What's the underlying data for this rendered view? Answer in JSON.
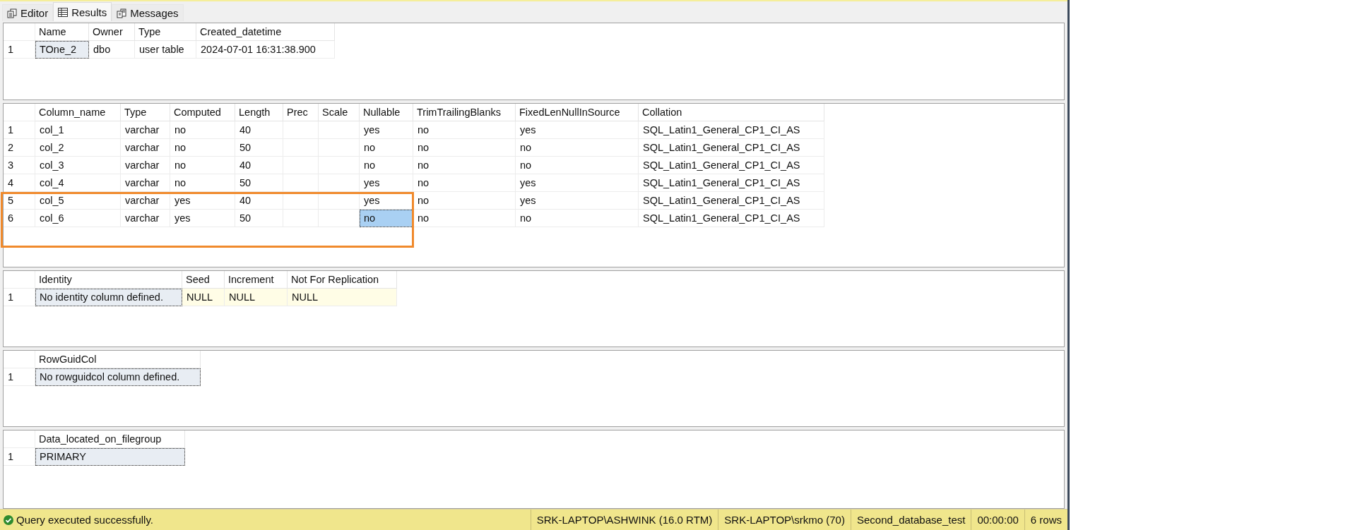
{
  "tabs": [
    {
      "label": "Editor",
      "kind": "editor",
      "selected": false
    },
    {
      "label": "Results",
      "kind": "grid",
      "selected": true
    },
    {
      "label": "Messages",
      "kind": "messages",
      "selected": false
    }
  ],
  "grids": [
    {
      "columns": [
        "Name",
        "Owner",
        "Type",
        "Created_datetime"
      ],
      "rows": [
        {
          "number": "1",
          "outlined": false,
          "cells": [
            {
              "text": "TOne_2",
              "focused": true,
              "selected": false,
              "null": false
            },
            {
              "text": "dbo",
              "focused": false,
              "selected": false,
              "null": false
            },
            {
              "text": "user table",
              "focused": false,
              "selected": false,
              "null": false
            },
            {
              "text": "2024-07-01 16:31:38.900",
              "focused": false,
              "selected": false,
              "null": false
            }
          ]
        }
      ]
    },
    {
      "columns": [
        "Column_name",
        "Type",
        "Computed",
        "Length",
        "Prec",
        "Scale",
        "Nullable",
        "TrimTrailingBlanks",
        "FixedLenNullInSource",
        "Collation"
      ],
      "rows": [
        {
          "number": "1",
          "outlined": false,
          "cells": [
            {
              "text": "col_1",
              "focused": false,
              "selected": false,
              "null": false
            },
            {
              "text": "varchar",
              "focused": false,
              "selected": false,
              "null": false
            },
            {
              "text": "no",
              "focused": false,
              "selected": false,
              "null": false
            },
            {
              "text": "40",
              "focused": false,
              "selected": false,
              "null": false
            },
            {
              "focused": false,
              "selected": false,
              "null": false
            },
            {
              "focused": false,
              "selected": false,
              "null": false
            },
            {
              "text": "yes",
              "focused": false,
              "selected": false,
              "null": false
            },
            {
              "text": "no",
              "focused": false,
              "selected": false,
              "null": false
            },
            {
              "text": "yes",
              "focused": false,
              "selected": false,
              "null": false
            },
            {
              "text": "SQL_Latin1_General_CP1_CI_AS",
              "focused": false,
              "selected": false,
              "null": false
            }
          ]
        },
        {
          "number": "2",
          "outlined": false,
          "cells": [
            {
              "text": "col_2",
              "focused": false,
              "selected": false,
              "null": false
            },
            {
              "text": "varchar",
              "focused": false,
              "selected": false,
              "null": false
            },
            {
              "text": "no",
              "focused": false,
              "selected": false,
              "null": false
            },
            {
              "text": "50",
              "focused": false,
              "selected": false,
              "null": false
            },
            {
              "focused": false,
              "selected": false,
              "null": false
            },
            {
              "focused": false,
              "selected": false,
              "null": false
            },
            {
              "text": "no",
              "focused": false,
              "selected": false,
              "null": false
            },
            {
              "text": "no",
              "focused": false,
              "selected": false,
              "null": false
            },
            {
              "text": "no",
              "focused": false,
              "selected": false,
              "null": false
            },
            {
              "text": "SQL_Latin1_General_CP1_CI_AS",
              "focused": false,
              "selected": false,
              "null": false
            }
          ]
        },
        {
          "number": "3",
          "outlined": false,
          "cells": [
            {
              "text": "col_3",
              "focused": false,
              "selected": false,
              "null": false
            },
            {
              "text": "varchar",
              "focused": false,
              "selected": false,
              "null": false
            },
            {
              "text": "no",
              "focused": false,
              "selected": false,
              "null": false
            },
            {
              "text": "40",
              "focused": false,
              "selected": false,
              "null": false
            },
            {
              "focused": false,
              "selected": false,
              "null": false
            },
            {
              "focused": false,
              "selected": false,
              "null": false
            },
            {
              "text": "no",
              "focused": false,
              "selected": false,
              "null": false
            },
            {
              "text": "no",
              "focused": false,
              "selected": false,
              "null": false
            },
            {
              "text": "no",
              "focused": false,
              "selected": false,
              "null": false
            },
            {
              "text": "SQL_Latin1_General_CP1_CI_AS",
              "focused": false,
              "selected": false,
              "null": false
            }
          ]
        },
        {
          "number": "4",
          "outlined": false,
          "cells": [
            {
              "text": "col_4",
              "focused": false,
              "selected": false,
              "null": false
            },
            {
              "text": "varchar",
              "focused": false,
              "selected": false,
              "null": false
            },
            {
              "text": "no",
              "focused": false,
              "selected": false,
              "null": false
            },
            {
              "text": "50",
              "focused": false,
              "selected": false,
              "null": false
            },
            {
              "focused": false,
              "selected": false,
              "null": false
            },
            {
              "focused": false,
              "selected": false,
              "null": false
            },
            {
              "text": "yes",
              "focused": false,
              "selected": false,
              "null": false
            },
            {
              "text": "no",
              "focused": false,
              "selected": false,
              "null": false
            },
            {
              "text": "yes",
              "focused": false,
              "selected": false,
              "null": false
            },
            {
              "text": "SQL_Latin1_General_CP1_CI_AS",
              "focused": false,
              "selected": false,
              "null": false
            }
          ]
        },
        {
          "number": "5",
          "outlined": true,
          "cells": [
            {
              "text": "col_5",
              "focused": false,
              "selected": false,
              "null": false
            },
            {
              "text": "varchar",
              "focused": false,
              "selected": false,
              "null": false
            },
            {
              "text": "yes",
              "focused": false,
              "selected": false,
              "null": false
            },
            {
              "text": "40",
              "focused": false,
              "selected": false,
              "null": false
            },
            {
              "focused": false,
              "selected": false,
              "null": false
            },
            {
              "focused": false,
              "selected": false,
              "null": false
            },
            {
              "text": "yes",
              "focused": false,
              "selected": false,
              "null": false
            },
            {
              "text": "no",
              "focused": false,
              "selected": false,
              "null": false
            },
            {
              "text": "yes",
              "focused": false,
              "selected": false,
              "null": false
            },
            {
              "text": "SQL_Latin1_General_CP1_CI_AS",
              "focused": false,
              "selected": false,
              "null": false
            }
          ]
        },
        {
          "number": "6",
          "outlined": true,
          "cells": [
            {
              "text": "col_6",
              "focused": false,
              "selected": false,
              "null": false
            },
            {
              "text": "varchar",
              "focused": false,
              "selected": false,
              "null": false
            },
            {
              "text": "yes",
              "focused": false,
              "selected": false,
              "null": false
            },
            {
              "text": "50",
              "focused": false,
              "selected": false,
              "null": false
            },
            {
              "focused": false,
              "selected": false,
              "null": false
            },
            {
              "focused": false,
              "selected": false,
              "null": false
            },
            {
              "text": "no",
              "focused": true,
              "selected": true,
              "null": false
            },
            {
              "text": "no",
              "focused": false,
              "selected": false,
              "null": false
            },
            {
              "text": "no",
              "focused": false,
              "selected": false,
              "null": false
            },
            {
              "text": "SQL_Latin1_General_CP1_CI_AS",
              "focused": false,
              "selected": false,
              "null": false
            }
          ]
        }
      ]
    },
    {
      "columns": [
        "Identity",
        "Seed",
        "Increment",
        "Not For Replication"
      ],
      "rows": [
        {
          "number": "1",
          "outlined": false,
          "cells": [
            {
              "text": "No identity column defined.",
              "focused": true,
              "selected": false,
              "null": false
            },
            {
              "text": "NULL",
              "focused": false,
              "selected": false,
              "null": true
            },
            {
              "text": "NULL",
              "focused": false,
              "selected": false,
              "null": true
            },
            {
              "text": "NULL",
              "focused": false,
              "selected": false,
              "null": true
            }
          ]
        }
      ]
    },
    {
      "columns": [
        "RowGuidCol"
      ],
      "rows": [
        {
          "number": "1",
          "outlined": false,
          "cells": [
            {
              "text": "No rowguidcol column defined.",
              "focused": true,
              "selected": false,
              "null": false
            }
          ]
        }
      ]
    },
    {
      "columns": [
        "Data_located_on_filegroup"
      ],
      "rows": [
        {
          "number": "1",
          "outlined": false,
          "cells": [
            {
              "text": "PRIMARY",
              "focused": true,
              "selected": false,
              "null": false
            }
          ]
        }
      ]
    }
  ],
  "status_bar": {
    "message": "Query executed successfully.",
    "success": true,
    "items": [
      "SRK-LAPTOP\\ASHWINK (16.0 RTM)",
      "SRK-LAPTOP\\srkmo (70)",
      "Second_database_test",
      "00:00:00",
      "6 rows"
    ]
  }
}
